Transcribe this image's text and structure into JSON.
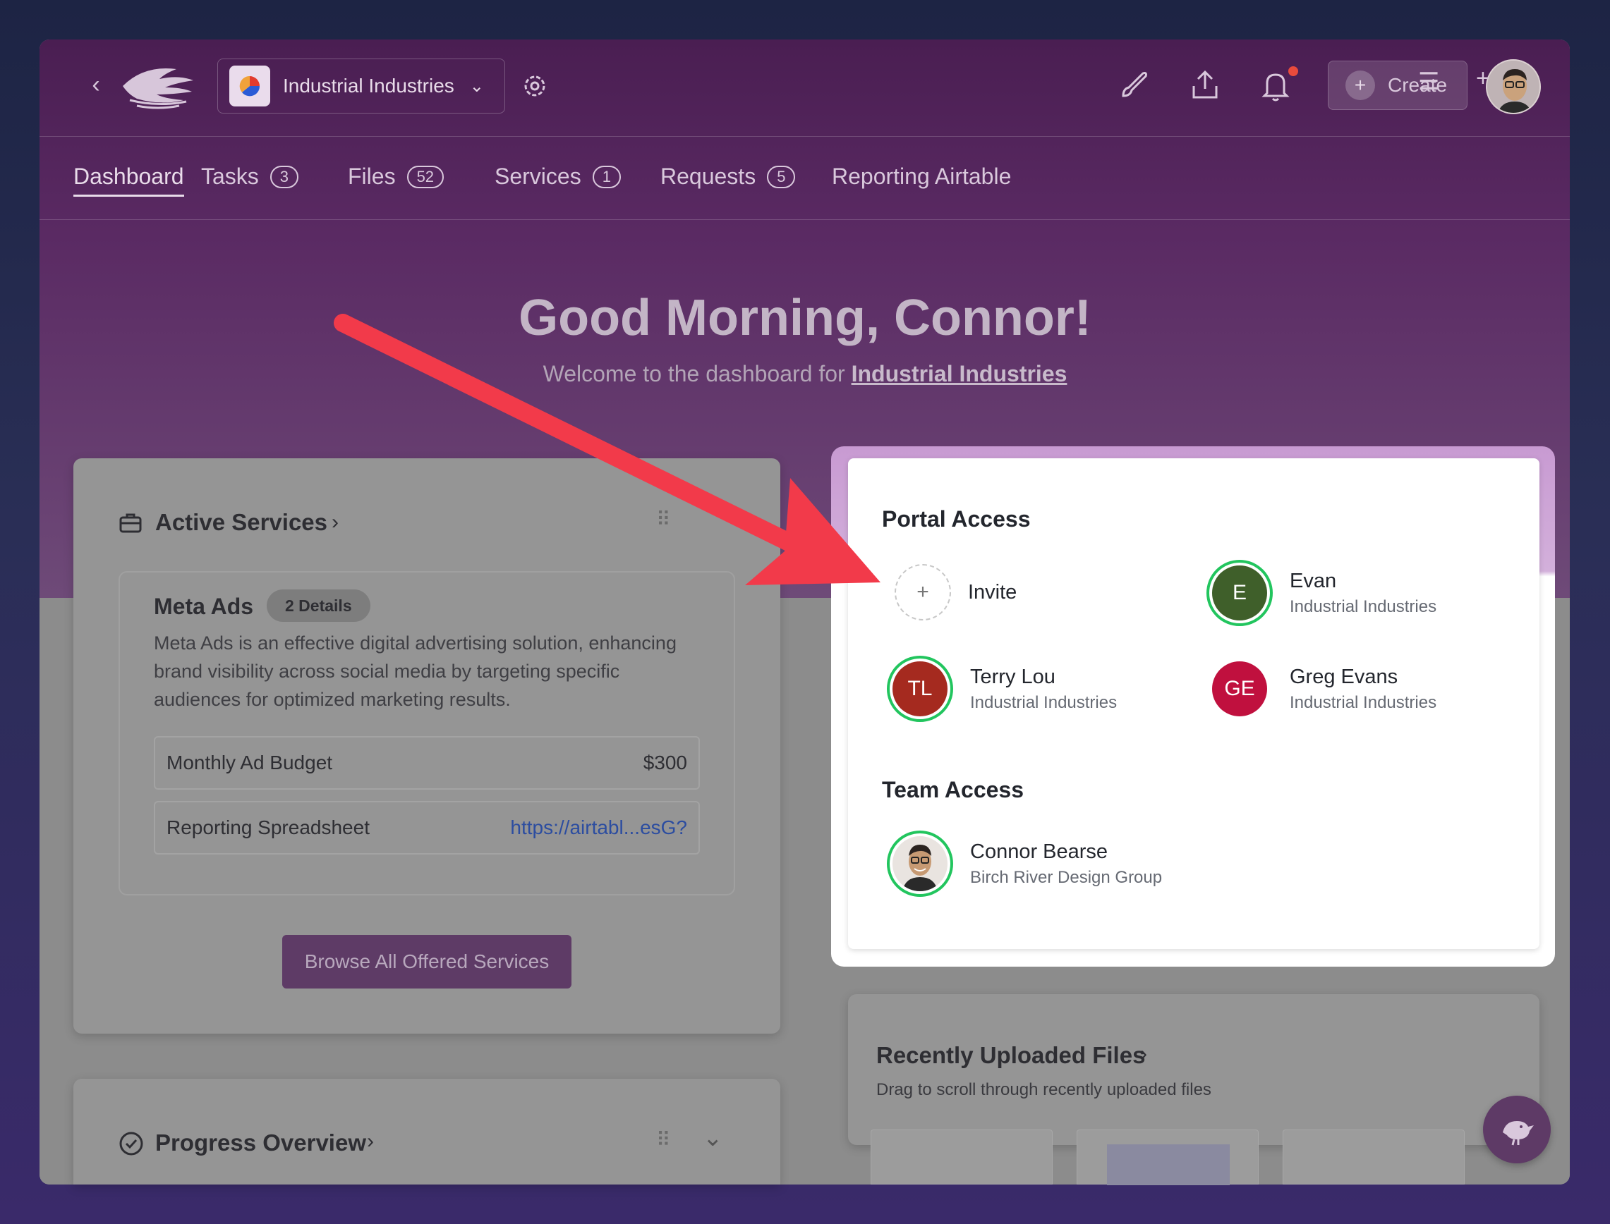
{
  "header": {
    "org_name": "Industrial Industries",
    "create_label": "Create"
  },
  "tabs": [
    {
      "label": "Dashboard",
      "count": ""
    },
    {
      "label": "Tasks",
      "count": "3"
    },
    {
      "label": "Files",
      "count": "52"
    },
    {
      "label": "Services",
      "count": "1"
    },
    {
      "label": "Requests",
      "count": "5"
    },
    {
      "label": "Reporting Airtable",
      "count": ""
    }
  ],
  "hero": {
    "greeting": "Good Morning, Connor!",
    "welcome_prefix": "Welcome to the dashboard for",
    "welcome_org": "Industrial Industries"
  },
  "active_services": {
    "title": "Active Services",
    "service": {
      "name": "Meta Ads",
      "badge": "2 Details",
      "description": "Meta Ads is an effective digital advertising solution, enhancing brand visibility across social media by targeting specific audiences for optimized marketing results.",
      "fields": [
        {
          "label": "Monthly Ad Budget",
          "value": "$300"
        },
        {
          "label": "Reporting Spreadsheet",
          "value": "https://airtabl...esG?"
        }
      ]
    },
    "browse_label": "Browse All Offered Services"
  },
  "progress": {
    "title": "Progress Overview"
  },
  "portal_access": {
    "title": "Portal Access",
    "invite_label": "Invite",
    "members": [
      {
        "initials": "E",
        "name": "Evan",
        "org": "Industrial Industries",
        "color": "#3f5f2a",
        "active": true
      },
      {
        "initials": "TL",
        "name": "Terry Lou",
        "org": "Industrial Industries",
        "color": "#a52a1f",
        "active": true
      },
      {
        "initials": "GE",
        "name": "Greg Evans",
        "org": "Industrial Industries",
        "color": "#c0103e",
        "active": false
      }
    ]
  },
  "team_access": {
    "title": "Team Access",
    "members": [
      {
        "name": "Connor Bearse",
        "org": "Birch River Design Group"
      }
    ]
  },
  "recent_files": {
    "title": "Recently Uploaded Files",
    "subtitle": "Drag to scroll through recently uploaded files"
  },
  "colors": {
    "accent": "#5e3b66",
    "annotation_arrow": "#f23a4a",
    "online_ring": "#22c55e"
  }
}
